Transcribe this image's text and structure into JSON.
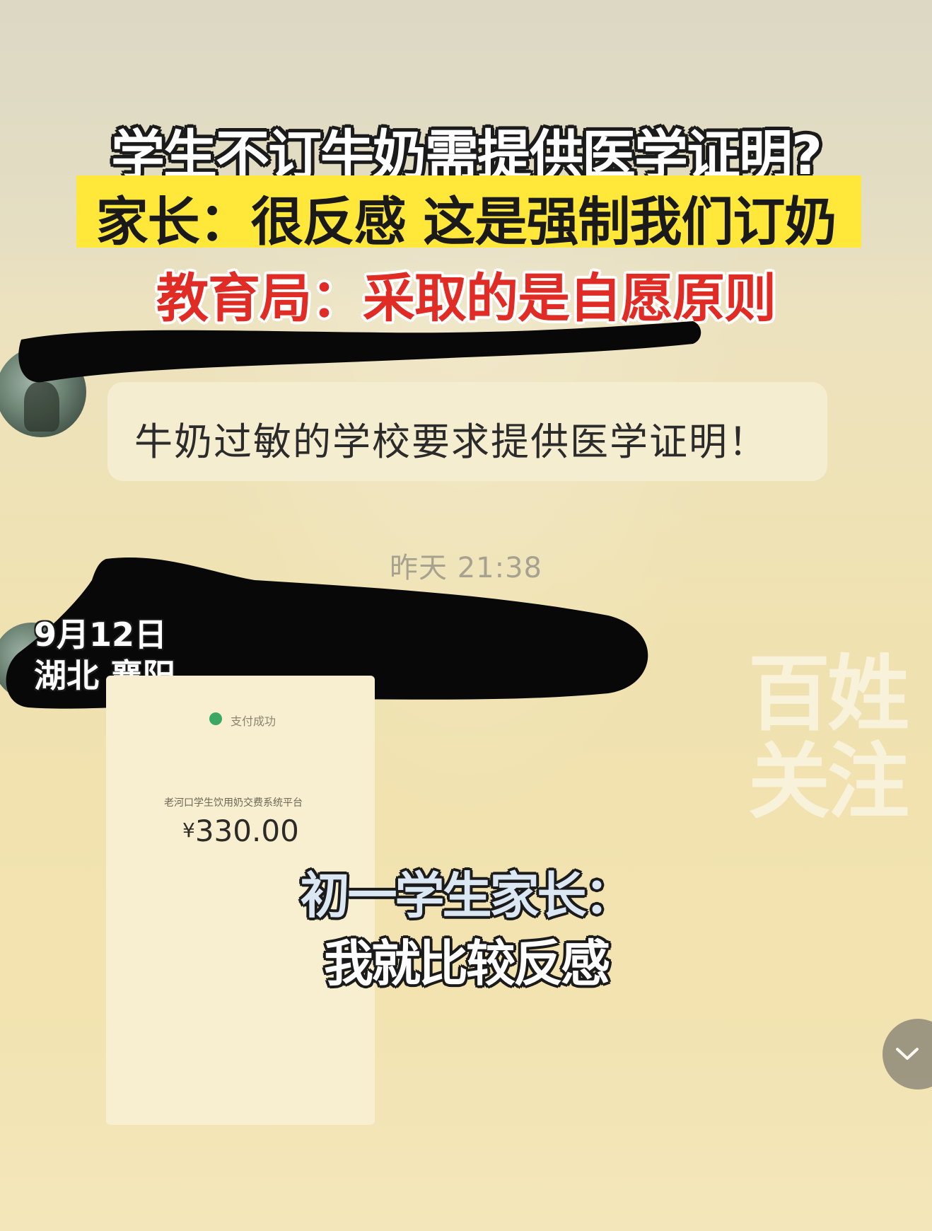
{
  "headline": {
    "line1": "学生不订牛奶需提供医学证明?",
    "line2": "家长：很反感 这是强制我们订奶",
    "line3": "教育局：采取的是自愿原则"
  },
  "chat": {
    "message_text": "牛奶过敏的学校要求提供医学证明！",
    "timestamp": "昨天 21:38"
  },
  "location_tag": {
    "date": "9月12日",
    "place": "湖北 襄阳"
  },
  "payment": {
    "status": "支付成功",
    "platform": "老河口学生饮用奶交费系统平台",
    "currency": "¥",
    "amount": "330.00"
  },
  "watermark": "百姓\n关注",
  "caption": {
    "line1": "初一学生家长：",
    "line2": "我就比较反感"
  },
  "icons": {
    "scroll_down": "chevron-down-icon"
  }
}
